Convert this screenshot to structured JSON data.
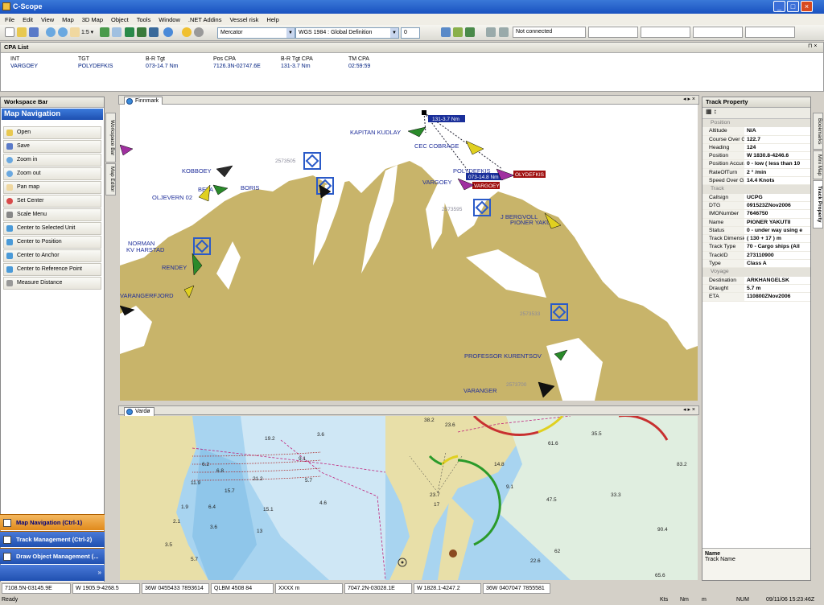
{
  "window": {
    "title": "C-Scope",
    "min": "_",
    "max": "□",
    "close": "×"
  },
  "menu": [
    "File",
    "Edit",
    "View",
    "Map",
    "3D Map",
    "Object",
    "Tools",
    "Window",
    ".NET Addins",
    "Vessel risk",
    "Help"
  ],
  "toolbar": {
    "scale": "1:5 ▾",
    "projection": "Mercator",
    "datum": "WGS 1984 : Global Definition",
    "spin_value": "0",
    "connection": "Not connected"
  },
  "cpa": {
    "title": "CPA List",
    "columns": [
      "INT",
      "TGT",
      "B-R Tgt",
      "Pos CPA",
      "B-R Tgt CPA",
      "TM CPA"
    ],
    "rows": [
      [
        "VARGOEY",
        "POLYDEFKIS",
        "073-14.7 Nm",
        "7126.3N-02747.6E",
        "131-3.7 Nm",
        "02:59:59"
      ]
    ]
  },
  "workspace": {
    "title": "Workspace Bar",
    "heading": "Map Navigation",
    "items": [
      "Open",
      "Save",
      "Zoom in",
      "Zoom out",
      "Pan map",
      "Set Center",
      "Scale Menu",
      "Center to Selected Unit",
      "Center to Position",
      "Center to Anchor",
      "Center to Reference Point",
      "Measure Distance"
    ],
    "nav": [
      "Map Navigation (Ctrl-1)",
      "Track Management (Ctrl-2)",
      "Draw Object Management (..."
    ],
    "vtabs": [
      "Workspace Bar",
      "Map Editor"
    ]
  },
  "map1": {
    "tab": "Finnmark",
    "labels": [
      "KAPITAN KUDLAY",
      "CEC COBRAGE",
      "POLYDEFKIS",
      "VARGOEY",
      "J BERGVOLL",
      "PIONER YAKUTI",
      "KOBBOEY",
      "OLJEVERN 02",
      "BETA",
      "BORIS",
      "KV HARSTAD",
      "NORMAN",
      "RENDEY",
      "VARANGERFJORD",
      "PROFESSOR KURENTSOV",
      "VARANGER"
    ],
    "tags": [
      "131-3.7 Nm",
      "073-14.8 Nm",
      "OLYDEFKIS",
      "VARGOEY"
    ],
    "ids": [
      "2573505",
      "2573595",
      "2573595",
      "2573533",
      "2573700"
    ]
  },
  "map2": {
    "tab": "Vardø",
    "depths": [
      "19.2",
      "3.6",
      "6.2",
      "11.9",
      "6.8",
      "15.7",
      "21.2",
      "5.7",
      "9.1",
      "6.4",
      "15.1",
      "13",
      "2.1",
      "1.9",
      "3.5",
      "5.7",
      "3.6",
      "4.6",
      "38.2",
      "23.6",
      "17",
      "61.6",
      "35.5",
      "14.8",
      "23.7",
      "62",
      "22.6",
      "9.1",
      "33.3",
      "90.4",
      "83.2",
      "47.5",
      "65.6"
    ]
  },
  "track": {
    "title": "Track Property",
    "sections": [
      {
        "name": "Position",
        "rows": [
          [
            "Altitude",
            "N/A"
          ],
          [
            "Course Over Gr",
            "122.7"
          ],
          [
            "Heading",
            "124"
          ],
          [
            "Position",
            "W 1830.8-4246.6"
          ],
          [
            "Position Accura",
            "0 - low ( less than 10"
          ],
          [
            "RateOfTurn",
            "2 ° /min"
          ],
          [
            "Speed Over Gro",
            "14.4 Knots"
          ]
        ]
      },
      {
        "name": "Track",
        "rows": [
          [
            "Callsign",
            "UCPG"
          ],
          [
            "DTG",
            "091523ZNov2006"
          ],
          [
            "IMONumber",
            "7646750"
          ],
          [
            "Name",
            "PIONER YAKUTII"
          ],
          [
            "Status",
            "0 - under way using e"
          ],
          [
            "Track Dimensio",
            "( 130 + 17 )  m"
          ],
          [
            "Track Type",
            "70 - Cargo ships (All"
          ],
          [
            "TrackID",
            "273110900"
          ],
          [
            "Type",
            "Class A"
          ]
        ]
      },
      {
        "name": "Voyage",
        "rows": [
          [
            "Destination",
            "ARKHANGELSK"
          ],
          [
            "Draught",
            "5.7 m"
          ],
          [
            "ETA",
            "110800ZNov2006"
          ]
        ]
      }
    ],
    "desc_title": "Name",
    "desc_text": "Track Name",
    "vtabs": [
      "Bookmarks",
      "Mini Map",
      "Track Property"
    ]
  },
  "status": {
    "fields": [
      "7108.5N-03145.9E",
      "W 1905.9-4268.5",
      "36W 0455433 7893614",
      "QLBM 4508 84",
      "XXXX m",
      "7047.2N-03028.1E",
      "W 1828.1-4247.2",
      "36W 0407047 7855581"
    ],
    "ready": "Ready",
    "kts": "Kts",
    "nm": "Nm",
    "m": "m",
    "num": "NUM",
    "datetime": "09/11/06  15:23:46Z"
  },
  "colors": {
    "land": "#c8b46a",
    "sea": "#ffffff",
    "shallow": "#8fc6ea",
    "accent": "#1a52c0",
    "nav": "#e9a040"
  }
}
